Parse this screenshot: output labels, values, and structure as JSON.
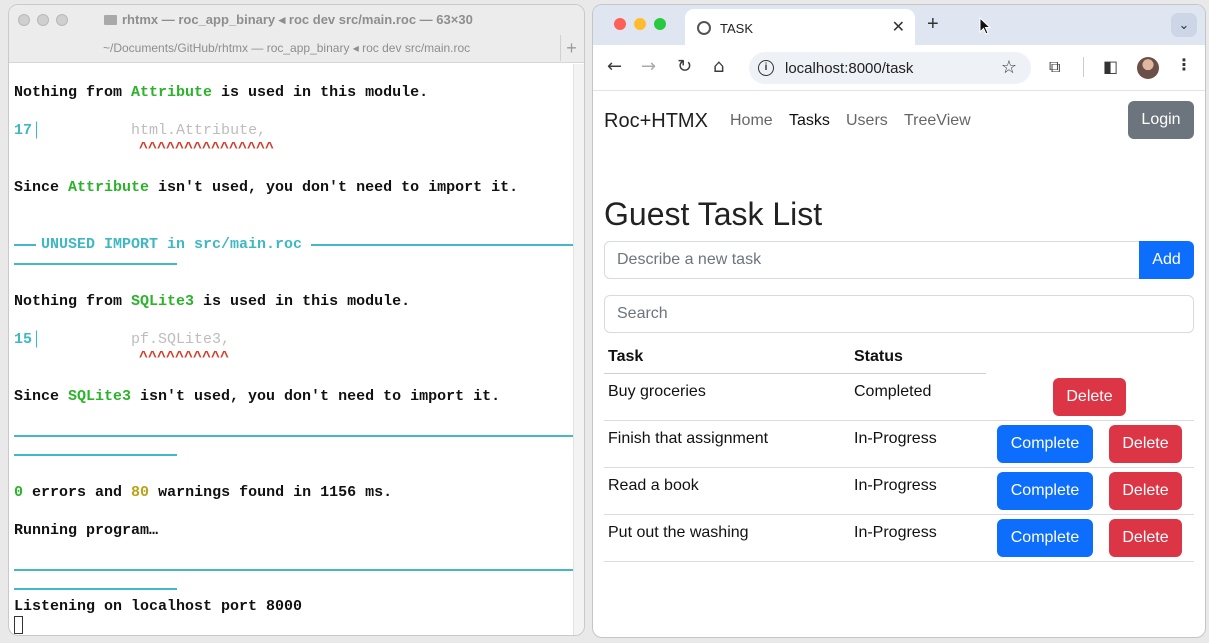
{
  "terminal": {
    "title": "rhtmx — roc_app_binary ◂ roc dev src/main.roc — 63×30",
    "subtitle": "~/Documents/GitHub/rhtmx — roc_app_binary ◂ roc dev src/main.roc",
    "new_tab": "+",
    "block1": {
      "line_pre": "Nothing from ",
      "name": "Attribute",
      "line_post": " is used in this module.",
      "line_number": "17",
      "code": "html.Attribute,",
      "carets": "^^^^^^^^^^^^^^^",
      "since_pre": "Since ",
      "since_name": "Attribute",
      "since_post": " isn't used, you don't need to import it."
    },
    "section_header": "UNUSED IMPORT in src/main.roc",
    "block2": {
      "line_pre": "Nothing from ",
      "name": "SQLite3",
      "line_post": " is used in this module.",
      "line_number": "15",
      "code": "pf.SQLite3,",
      "carets": "^^^^^^^^^^",
      "since_pre": "Since ",
      "since_name": "SQLite3",
      "since_post": " isn't used, you don't need to import it."
    },
    "summary": {
      "errors": "0",
      "errors_label": " errors and ",
      "warnings": "80",
      "warnings_label": " warnings found in 1156 ms."
    },
    "running": "Running program…",
    "listening": "Listening on localhost port 8000"
  },
  "browser": {
    "tab_title": "TASK",
    "url": "localhost:8000/task",
    "icons": [
      "back-arrow-icon",
      "forward-arrow-icon",
      "reload-icon",
      "home-icon",
      "info-icon",
      "star-icon",
      "extensions-icon",
      "sidebar-icon",
      "avatar",
      "kebab-menu-icon"
    ]
  },
  "page": {
    "brand": "Roc+HTMX",
    "nav": [
      "Home",
      "Tasks",
      "Users",
      "TreeView"
    ],
    "active_nav": "Tasks",
    "login": "Login",
    "title": "Guest Task List",
    "new_task_placeholder": "Describe a new task",
    "add": "Add",
    "search_placeholder": "Search",
    "headers": {
      "task": "Task",
      "status": "Status"
    },
    "complete_label": "Complete",
    "delete_label": "Delete",
    "tasks": [
      {
        "task": "Buy groceries",
        "status": "Completed"
      },
      {
        "task": "Finish that assignment",
        "status": "In-Progress"
      },
      {
        "task": "Read a book",
        "status": "In-Progress"
      },
      {
        "task": "Put out the washing",
        "status": "In-Progress"
      }
    ]
  },
  "colors": {
    "primary": "#0d6efd",
    "danger": "#dc3545",
    "secondary": "#6c757d",
    "terminal_green": "#2bb32b",
    "terminal_cyan": "#3fb8c4",
    "terminal_red": "#d43c2c"
  }
}
